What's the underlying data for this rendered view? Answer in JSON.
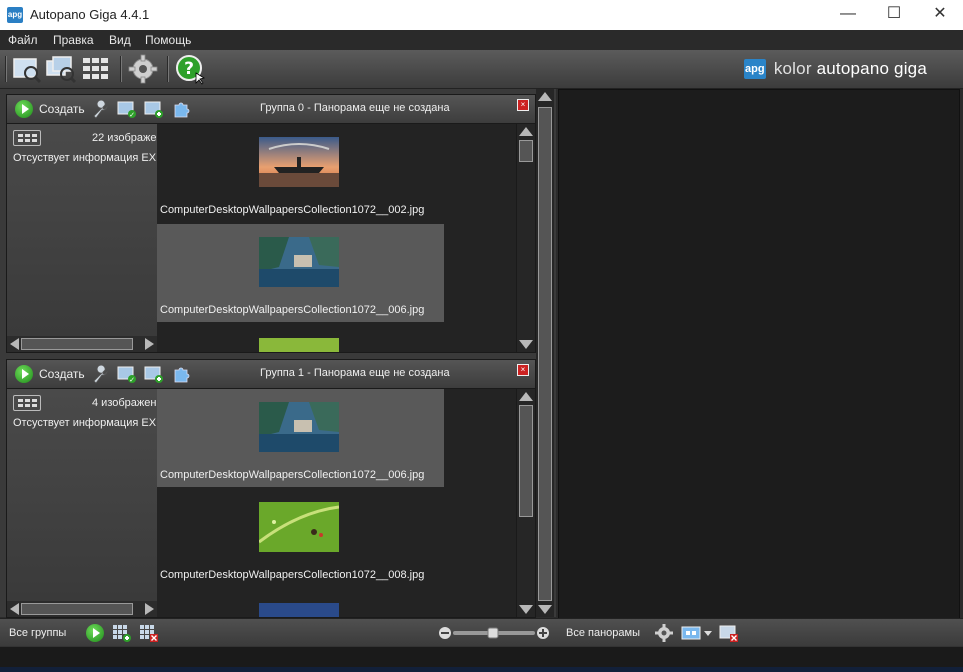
{
  "window": {
    "title": "Autopano Giga 4.4.1",
    "icon_text": "apg",
    "controls": {
      "minimize": "—",
      "maximize": "☐",
      "close": "✕"
    }
  },
  "menu": {
    "items": [
      {
        "label": "Файл"
      },
      {
        "label": "Правка"
      },
      {
        "label": "Вид"
      },
      {
        "label": "Помощь"
      }
    ]
  },
  "toolbar": {
    "brand_badge": "apg",
    "brand_kolor": "kolor",
    "brand_product": "autopano giga",
    "buttons": [
      "detect-icon",
      "add-images-icon",
      "grid-icon",
      "settings-gear-icon",
      "help-icon"
    ]
  },
  "groups": [
    {
      "create_label": "Создать",
      "title": "Группа 0 - Панорама еще не создана",
      "image_count": "22 изображе",
      "exif_info": "Отсуствует информация EX",
      "thumbs": [
        {
          "name": "ComputerDesktopWallpapersCollection1072__002.jpg",
          "selected": false,
          "scene": "sunset-ship"
        },
        {
          "name": "ComputerDesktopWallpapersCollection1072__006.jpg",
          "selected": true,
          "scene": "lake-town"
        }
      ]
    },
    {
      "create_label": "Создать",
      "title": "Группа 1 - Панорама еще не создана",
      "image_count": "4 изображен",
      "exif_info": "Отсуствует информация EX",
      "thumbs": [
        {
          "name": "ComputerDesktopWallpapersCollection1072__006.jpg",
          "selected": true,
          "scene": "lake-town"
        },
        {
          "name": "ComputerDesktopWallpapersCollection1072__008.jpg",
          "selected": false,
          "scene": "green-leaf"
        }
      ]
    }
  ],
  "bottom": {
    "all_groups": "Все группы",
    "all_panoramas": "Все панорамы"
  },
  "colors": {
    "accent_green": "#2ea02a",
    "brand_blue": "#2a84c8",
    "close_red": "#cc2222"
  }
}
